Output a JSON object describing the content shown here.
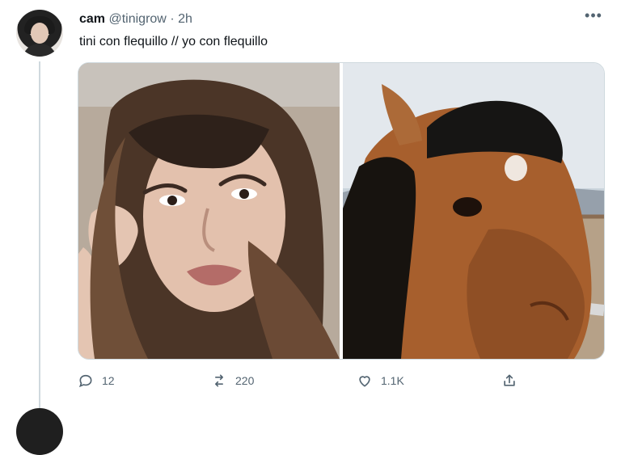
{
  "tweet": {
    "name": "cam",
    "handle": "@tinigrow",
    "separator": "·",
    "time": "2h",
    "text": "tini con flequillo // yo con flequillo",
    "actions": {
      "replies": "12",
      "retweets": "220",
      "likes": "1.1K"
    }
  },
  "icons": [
    "more-icon",
    "reply-icon",
    "retweet-icon",
    "like-icon",
    "share-icon"
  ],
  "colors": {
    "text": "#0f1419",
    "muted": "#536471",
    "border": "#cfd9de"
  }
}
